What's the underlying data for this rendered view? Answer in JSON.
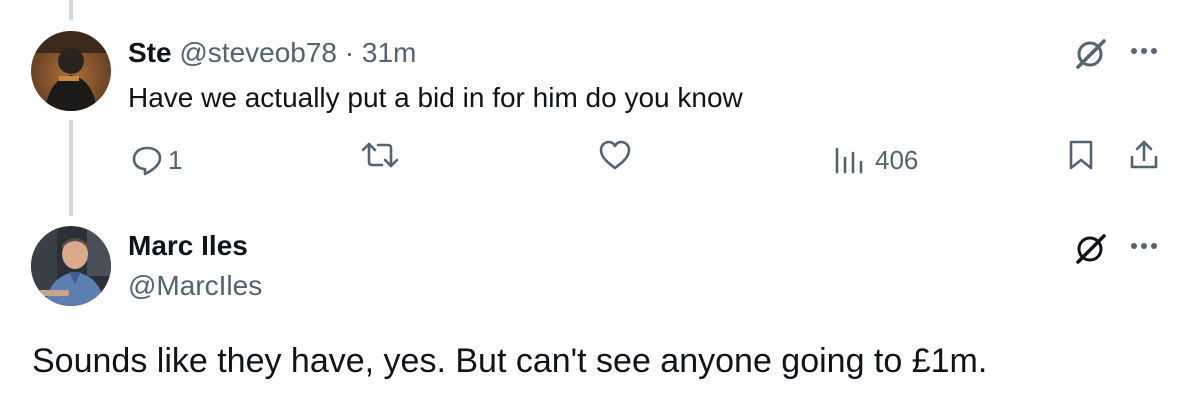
{
  "tweet1": {
    "name": "Ste",
    "handle": "@steveob78",
    "separator": "·",
    "time": "31m",
    "text": "Have we actually put a bid in for him do you know",
    "actions": {
      "reply_count": "1",
      "views_count": "406"
    }
  },
  "tweet2": {
    "name": "Marc Iles",
    "handle": "@MarcIles",
    "text": "Sounds like they have, yes. But can't see anyone going to £1m."
  },
  "icons": {
    "grok": "grok-icon",
    "more": "more-icon",
    "reply": "reply-icon",
    "retweet": "retweet-icon",
    "like": "like-icon",
    "views": "views-icon",
    "bookmark": "bookmark-icon",
    "share": "share-icon"
  },
  "colors": {
    "text": "#0f1419",
    "muted": "#536471",
    "thread_line": "#cfd9de"
  }
}
